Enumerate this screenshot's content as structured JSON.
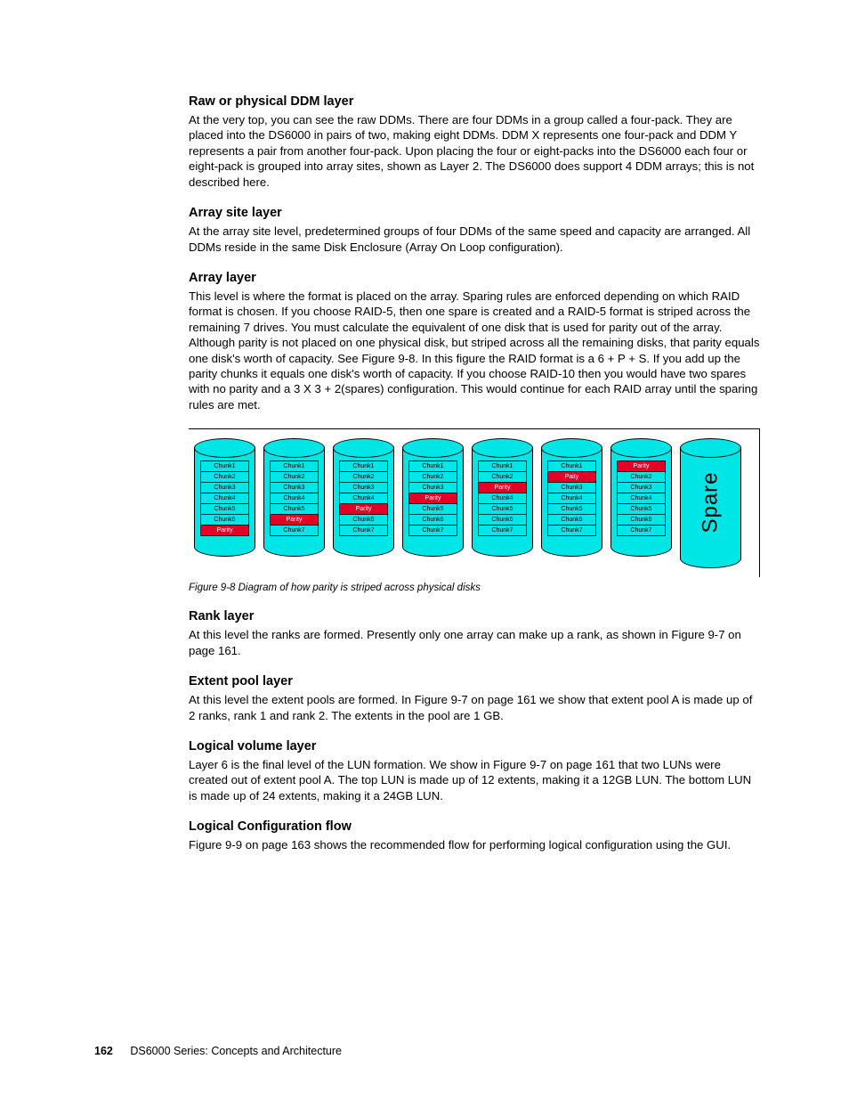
{
  "sections": {
    "s1": {
      "title": "Raw or physical DDM layer",
      "p": "At the very top, you can see the raw DDMs. There are four DDMs in a group called a four-pack. They are placed into the DS6000 in pairs of two, making eight DDMs. DDM X represents one four-pack and DDM Y represents a pair from another four-pack. Upon placing the four or eight-packs into the DS6000 each four or eight-pack is grouped into array sites, shown as Layer 2. The DS6000 does support 4 DDM arrays; this is not described here."
    },
    "s2": {
      "title": "Array site layer",
      "p": "At the array site level, predetermined groups of four DDMs of the same speed and capacity are arranged. All DDMs reside in the same Disk Enclosure (Array On Loop configuration)."
    },
    "s3": {
      "title": "Array layer",
      "p": "This level is where the format is placed on the array. Sparing rules are enforced depending on which RAID format is chosen. If you choose RAID-5, then one spare is created and a RAID-5 format is striped across the remaining 7 drives. You must calculate the equivalent of one disk that is used for parity out of the array. Although parity is not placed on one physical disk, but striped across all the remaining disks, that parity equals one disk's worth of capacity. See Figure 9-8. In this figure the RAID format is a 6 + P + S. If you add up the parity chunks it equals one disk's worth of capacity. If you choose RAID-10 then you would have two spares with no parity and a 3 X 3 + 2(spares) configuration. This would continue for each RAID array until the sparing rules are met."
    },
    "s4": {
      "title": "Rank layer",
      "p": "At this level the ranks are formed. Presently only one array can make up a rank, as shown in Figure 9-7 on page 161."
    },
    "s5": {
      "title": "Extent pool layer",
      "p": "At this level the extent pools are formed. In Figure 9-7 on page 161 we show that extent pool A is made up of 2 ranks, rank 1 and rank 2. The extents in the pool are 1 GB."
    },
    "s6": {
      "title": "Logical volume layer",
      "p": "Layer 6 is the final level of the LUN formation. We show in Figure 9-7 on page 161 that two LUNs were created out of extent pool A. The top LUN is made up of 12 extents, making it a 12GB LUN. The bottom LUN is made up of 24 extents, making it a 24GB LUN."
    },
    "s7": {
      "title": "Logical Configuration flow",
      "p": "Figure 9-9 on page 163 shows the recommended flow for performing logical configuration using the GUI."
    }
  },
  "chart_data": {
    "type": "table",
    "caption": "Figure 9-8   Diagram of how parity is striped across physical disks",
    "spare_label": "Spare",
    "disks": [
      {
        "cells": [
          {
            "t": "Chunk1",
            "p": false
          },
          {
            "t": "Chunk2",
            "p": false
          },
          {
            "t": "Chunk3",
            "p": false
          },
          {
            "t": "Chunk4",
            "p": false
          },
          {
            "t": "Chunk5",
            "p": false
          },
          {
            "t": "Chunk6",
            "p": false
          },
          {
            "t": "Parity",
            "p": true
          }
        ]
      },
      {
        "cells": [
          {
            "t": "Chunk1",
            "p": false
          },
          {
            "t": "Chunk2",
            "p": false
          },
          {
            "t": "Chunk3",
            "p": false
          },
          {
            "t": "Chunk4",
            "p": false
          },
          {
            "t": "Chunk5",
            "p": false
          },
          {
            "t": "Parity",
            "p": true
          },
          {
            "t": "Chunk7",
            "p": false
          }
        ]
      },
      {
        "cells": [
          {
            "t": "Chunk1",
            "p": false
          },
          {
            "t": "Chunk2",
            "p": false
          },
          {
            "t": "Chunk3",
            "p": false
          },
          {
            "t": "Chunk4",
            "p": false
          },
          {
            "t": "Parity",
            "p": true
          },
          {
            "t": "Chunk6",
            "p": false
          },
          {
            "t": "Chunk7",
            "p": false
          }
        ]
      },
      {
        "cells": [
          {
            "t": "Chunk1",
            "p": false
          },
          {
            "t": "Chunk2",
            "p": false
          },
          {
            "t": "Chunk3",
            "p": false
          },
          {
            "t": "Parity",
            "p": true
          },
          {
            "t": "Chunk5",
            "p": false
          },
          {
            "t": "Chunk6",
            "p": false
          },
          {
            "t": "Chunk7",
            "p": false
          }
        ]
      },
      {
        "cells": [
          {
            "t": "Chunk1",
            "p": false
          },
          {
            "t": "Chunk2",
            "p": false
          },
          {
            "t": "Parity",
            "p": true
          },
          {
            "t": "Chunk4",
            "p": false
          },
          {
            "t": "Chunk5",
            "p": false
          },
          {
            "t": "Chunk6",
            "p": false
          },
          {
            "t": "Chunk7",
            "p": false
          }
        ]
      },
      {
        "cells": [
          {
            "t": "Chunk1",
            "p": false
          },
          {
            "t": "Paity",
            "p": true
          },
          {
            "t": "Chunk3",
            "p": false
          },
          {
            "t": "Chunk4",
            "p": false
          },
          {
            "t": "Chunk5",
            "p": false
          },
          {
            "t": "Chunk6",
            "p": false
          },
          {
            "t": "Chunk7",
            "p": false
          }
        ]
      },
      {
        "cells": [
          {
            "t": "Parity",
            "p": true
          },
          {
            "t": "Chunk2",
            "p": false
          },
          {
            "t": "Chunk3",
            "p": false
          },
          {
            "t": "Chunk4",
            "p": false
          },
          {
            "t": "Chunk5",
            "p": false
          },
          {
            "t": "Chunk6",
            "p": false
          },
          {
            "t": "Chunk7",
            "p": false
          }
        ]
      }
    ]
  },
  "footer": {
    "page": "162",
    "book": "DS6000 Series: Concepts and Architecture"
  }
}
